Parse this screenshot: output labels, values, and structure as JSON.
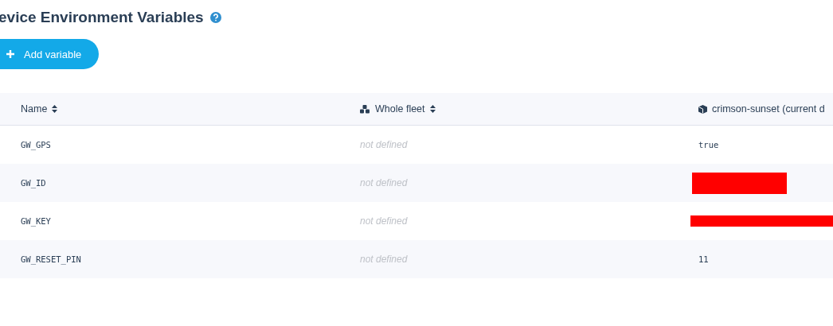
{
  "title": "evice Environment Variables",
  "add_button": {
    "label": "Add variable"
  },
  "table": {
    "columns": [
      {
        "label": "Name"
      },
      {
        "label": "Whole fleet"
      },
      {
        "label": "crimson-sunset (current d"
      }
    ],
    "rows": [
      {
        "name": "GW_GPS",
        "fleet": "not defined",
        "device": {
          "kind": "text",
          "value": "true"
        }
      },
      {
        "name": "GW_ID",
        "fleet": "not defined",
        "device": {
          "kind": "block"
        }
      },
      {
        "name": "GW_KEY",
        "fleet": "not defined",
        "device": {
          "kind": "strip"
        }
      },
      {
        "name": "GW_RESET_PIN",
        "fleet": "not defined",
        "device": {
          "kind": "text",
          "value": "11"
        }
      }
    ]
  }
}
